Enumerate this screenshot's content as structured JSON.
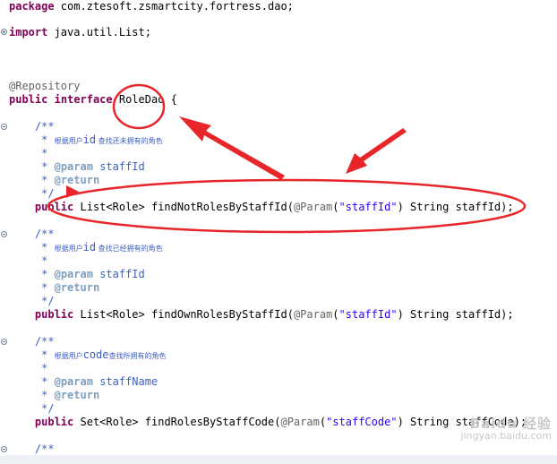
{
  "code": {
    "package_kw": "package",
    "package_name": " com.ztesoft.zsmartcity.fortress.dao;",
    "import_kw": "import",
    "import_name": " java.util.List;",
    "annotation_repository": "@Repository",
    "public_kw": "public",
    "interface_kw": "interface",
    "class_name": "RoleDao",
    "open_brace": " {",
    "comment_open": "/**",
    "comment_star": "*",
    "comment_close": "*/",
    "param_tag": "@param",
    "return_tag": "@return",
    "method1": {
      "doc_desc_prefix": "根据用户",
      "doc_desc_code": "id",
      "doc_desc_suffix": " 查找还未拥有的角色",
      "param_name": "staffId",
      "return_type": "List<Role>",
      "method_name": "findNotRolesByStaffId(",
      "param_annotation": "@Param",
      "param_open": "(",
      "param_string": "\"staffId\"",
      "param_rest": ") String staffId);"
    },
    "method2": {
      "doc_desc_prefix": "根据用户",
      "doc_desc_code": "id",
      "doc_desc_suffix": " 查找已经拥有的角色",
      "param_name": "staffId",
      "return_type": "List<Role>",
      "method_name": "findOwnRolesByStaffId(",
      "param_annotation": "@Param",
      "param_open": "(",
      "param_string": "\"staffId\"",
      "param_rest": ") String staffId);"
    },
    "method3": {
      "doc_desc_prefix": "根据用户",
      "doc_desc_code": "code",
      "doc_desc_suffix": "查找所拥有的角色",
      "param_name": "staffName",
      "return_type": "Set<Role>",
      "method_name": "findRolesByStaffCode(",
      "param_annotation": "@Param",
      "param_open": "(",
      "param_string": "\"staffCode\"",
      "param_rest": ") String staffCode);"
    }
  },
  "watermark": {
    "line1": "Baidu 经验",
    "line2": "jingyan.baidu.com"
  },
  "colors": {
    "keyword": "#7f0055",
    "annotation": "#646464",
    "javadoc": "#3f5fbf",
    "javadoc_tag": "#7f9fbf",
    "string": "#2a00ff",
    "markup_red": "#e8262a"
  },
  "icons": [
    "fold-expand-icon",
    "fold-collapse-icon",
    "red-circle-highlight",
    "red-ellipse-highlight",
    "red-arrow"
  ]
}
